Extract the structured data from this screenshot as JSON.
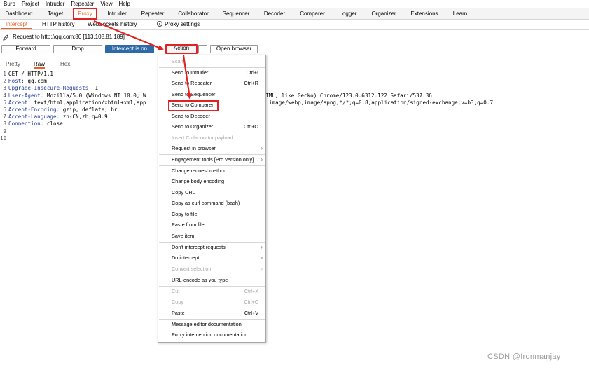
{
  "menubar": [
    "Burp",
    "Project",
    "Intruder",
    "Repeater",
    "View",
    "Help"
  ],
  "tool_tabs": [
    "Dashboard",
    "Target",
    "Proxy",
    "Intruder",
    "Repeater",
    "Collaborator",
    "Sequencer",
    "Decoder",
    "Comparer",
    "Logger",
    "Organizer",
    "Extensions",
    "Learn"
  ],
  "proxy_tabs": [
    "Intercept",
    "HTTP history",
    "WebSockets history"
  ],
  "proxy_settings": "Proxy settings",
  "request_info": "Request to http://qq.com:80  [113.108.81.189]",
  "buttons": {
    "forward": "Forward",
    "drop": "Drop",
    "intercept": "Intercept is on",
    "action": "Action",
    "open_browser": "Open browser"
  },
  "editor_tabs": [
    "Pretty",
    "Raw",
    "Hex"
  ],
  "editor_lines": [
    {
      "num": "1",
      "name": "",
      "text": "GET / HTTP/1.1"
    },
    {
      "num": "2",
      "name": "Host:",
      "text": " qq.com"
    },
    {
      "num": "3",
      "name": "Upgrade-Insecure-Requests:",
      "text": " 1"
    },
    {
      "num": "4",
      "name": "User-Agent:",
      "text": " Mozilla/5.0 (Windows NT 10.0; W",
      "tail": "KHTML, like Gecko) Chrome/123.0.6312.122 Safari/537.36"
    },
    {
      "num": "5",
      "name": "Accept:",
      "text": " text/html,application/xhtml+xml,app",
      "tail": "image/webp,image/apng,*/*;q=0.8,application/signed-exchange;v=b3;q=0.7"
    },
    {
      "num": "6",
      "name": "Accept-Encoding:",
      "text": " gzip, deflate, br"
    },
    {
      "num": "7",
      "name": "Accept-Language:",
      "text": " zh-CN,zh;q=0.9"
    },
    {
      "num": "8",
      "name": "Connection:",
      "text": " close"
    },
    {
      "num": "9",
      "name": "",
      "text": ""
    },
    {
      "num": "10",
      "name": "",
      "text": ""
    }
  ],
  "context_menu": {
    "scan": "Scan",
    "send_to_intruder": "Send to Intruder",
    "send_to_intruder_sc": "Ctrl+I",
    "send_to_repeater": "Send to Repeater",
    "send_to_repeater_sc": "Ctrl+R",
    "send_to_sequencer": "Send to Sequencer",
    "send_to_comparer": "Send to Comparer",
    "send_to_decoder": "Send to Decoder",
    "send_to_organizer": "Send to Organizer",
    "send_to_organizer_sc": "Ctrl+O",
    "insert_collaborator": "Insert Collaborator payload",
    "request_in_browser": "Request in browser",
    "engagement_tools": "Engagement tools [Pro version only]",
    "change_request_method": "Change request method",
    "change_body_encoding": "Change body encoding",
    "copy_url": "Copy URL",
    "copy_curl": "Copy as curl command (bash)",
    "copy_to_file": "Copy to file",
    "paste_from_file": "Paste from file",
    "save_item": "Save item",
    "dont_intercept": "Don't intercept requests",
    "do_intercept": "Do intercept",
    "convert_selection": "Convert selection",
    "url_encode": "URL-encode as you type",
    "cut": "Cut",
    "cut_sc": "Ctrl+X",
    "copy": "Copy",
    "copy_sc": "Ctrl+C",
    "paste": "Paste",
    "paste_sc": "Ctrl+V",
    "msg_editor_doc": "Message editor documentation",
    "proxy_intercept_doc": "Proxy interception documentation"
  },
  "watermark": "CSDN @Ironmanjay",
  "colors": {
    "accent": "#e8612c",
    "annotation_red": "#e22222",
    "primary_button": "#2f6aa8",
    "header_name": "#1f3c99"
  }
}
